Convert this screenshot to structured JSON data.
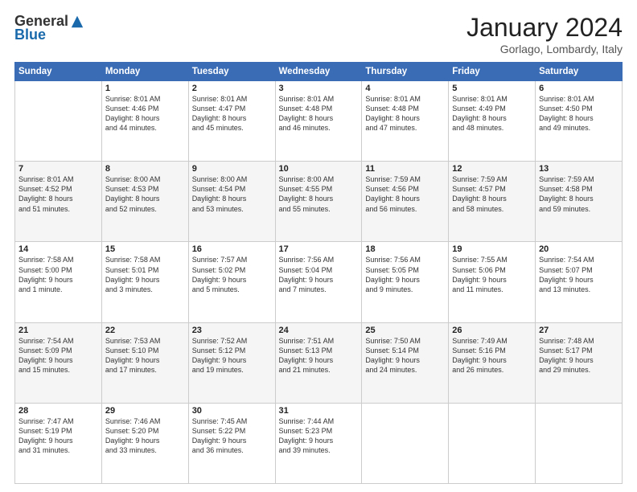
{
  "header": {
    "logo_general": "General",
    "logo_blue": "Blue",
    "month_title": "January 2024",
    "location": "Gorlago, Lombardy, Italy"
  },
  "weekdays": [
    "Sunday",
    "Monday",
    "Tuesday",
    "Wednesday",
    "Thursday",
    "Friday",
    "Saturday"
  ],
  "weeks": [
    [
      {
        "day": "",
        "info": ""
      },
      {
        "day": "1",
        "info": "Sunrise: 8:01 AM\nSunset: 4:46 PM\nDaylight: 8 hours\nand 44 minutes."
      },
      {
        "day": "2",
        "info": "Sunrise: 8:01 AM\nSunset: 4:47 PM\nDaylight: 8 hours\nand 45 minutes."
      },
      {
        "day": "3",
        "info": "Sunrise: 8:01 AM\nSunset: 4:48 PM\nDaylight: 8 hours\nand 46 minutes."
      },
      {
        "day": "4",
        "info": "Sunrise: 8:01 AM\nSunset: 4:48 PM\nDaylight: 8 hours\nand 47 minutes."
      },
      {
        "day": "5",
        "info": "Sunrise: 8:01 AM\nSunset: 4:49 PM\nDaylight: 8 hours\nand 48 minutes."
      },
      {
        "day": "6",
        "info": "Sunrise: 8:01 AM\nSunset: 4:50 PM\nDaylight: 8 hours\nand 49 minutes."
      }
    ],
    [
      {
        "day": "7",
        "info": "Sunrise: 8:01 AM\nSunset: 4:52 PM\nDaylight: 8 hours\nand 51 minutes."
      },
      {
        "day": "8",
        "info": "Sunrise: 8:00 AM\nSunset: 4:53 PM\nDaylight: 8 hours\nand 52 minutes."
      },
      {
        "day": "9",
        "info": "Sunrise: 8:00 AM\nSunset: 4:54 PM\nDaylight: 8 hours\nand 53 minutes."
      },
      {
        "day": "10",
        "info": "Sunrise: 8:00 AM\nSunset: 4:55 PM\nDaylight: 8 hours\nand 55 minutes."
      },
      {
        "day": "11",
        "info": "Sunrise: 7:59 AM\nSunset: 4:56 PM\nDaylight: 8 hours\nand 56 minutes."
      },
      {
        "day": "12",
        "info": "Sunrise: 7:59 AM\nSunset: 4:57 PM\nDaylight: 8 hours\nand 58 minutes."
      },
      {
        "day": "13",
        "info": "Sunrise: 7:59 AM\nSunset: 4:58 PM\nDaylight: 8 hours\nand 59 minutes."
      }
    ],
    [
      {
        "day": "14",
        "info": "Sunrise: 7:58 AM\nSunset: 5:00 PM\nDaylight: 9 hours\nand 1 minute."
      },
      {
        "day": "15",
        "info": "Sunrise: 7:58 AM\nSunset: 5:01 PM\nDaylight: 9 hours\nand 3 minutes."
      },
      {
        "day": "16",
        "info": "Sunrise: 7:57 AM\nSunset: 5:02 PM\nDaylight: 9 hours\nand 5 minutes."
      },
      {
        "day": "17",
        "info": "Sunrise: 7:56 AM\nSunset: 5:04 PM\nDaylight: 9 hours\nand 7 minutes."
      },
      {
        "day": "18",
        "info": "Sunrise: 7:56 AM\nSunset: 5:05 PM\nDaylight: 9 hours\nand 9 minutes."
      },
      {
        "day": "19",
        "info": "Sunrise: 7:55 AM\nSunset: 5:06 PM\nDaylight: 9 hours\nand 11 minutes."
      },
      {
        "day": "20",
        "info": "Sunrise: 7:54 AM\nSunset: 5:07 PM\nDaylight: 9 hours\nand 13 minutes."
      }
    ],
    [
      {
        "day": "21",
        "info": "Sunrise: 7:54 AM\nSunset: 5:09 PM\nDaylight: 9 hours\nand 15 minutes."
      },
      {
        "day": "22",
        "info": "Sunrise: 7:53 AM\nSunset: 5:10 PM\nDaylight: 9 hours\nand 17 minutes."
      },
      {
        "day": "23",
        "info": "Sunrise: 7:52 AM\nSunset: 5:12 PM\nDaylight: 9 hours\nand 19 minutes."
      },
      {
        "day": "24",
        "info": "Sunrise: 7:51 AM\nSunset: 5:13 PM\nDaylight: 9 hours\nand 21 minutes."
      },
      {
        "day": "25",
        "info": "Sunrise: 7:50 AM\nSunset: 5:14 PM\nDaylight: 9 hours\nand 24 minutes."
      },
      {
        "day": "26",
        "info": "Sunrise: 7:49 AM\nSunset: 5:16 PM\nDaylight: 9 hours\nand 26 minutes."
      },
      {
        "day": "27",
        "info": "Sunrise: 7:48 AM\nSunset: 5:17 PM\nDaylight: 9 hours\nand 29 minutes."
      }
    ],
    [
      {
        "day": "28",
        "info": "Sunrise: 7:47 AM\nSunset: 5:19 PM\nDaylight: 9 hours\nand 31 minutes."
      },
      {
        "day": "29",
        "info": "Sunrise: 7:46 AM\nSunset: 5:20 PM\nDaylight: 9 hours\nand 33 minutes."
      },
      {
        "day": "30",
        "info": "Sunrise: 7:45 AM\nSunset: 5:22 PM\nDaylight: 9 hours\nand 36 minutes."
      },
      {
        "day": "31",
        "info": "Sunrise: 7:44 AM\nSunset: 5:23 PM\nDaylight: 9 hours\nand 39 minutes."
      },
      {
        "day": "",
        "info": ""
      },
      {
        "day": "",
        "info": ""
      },
      {
        "day": "",
        "info": ""
      }
    ]
  ]
}
